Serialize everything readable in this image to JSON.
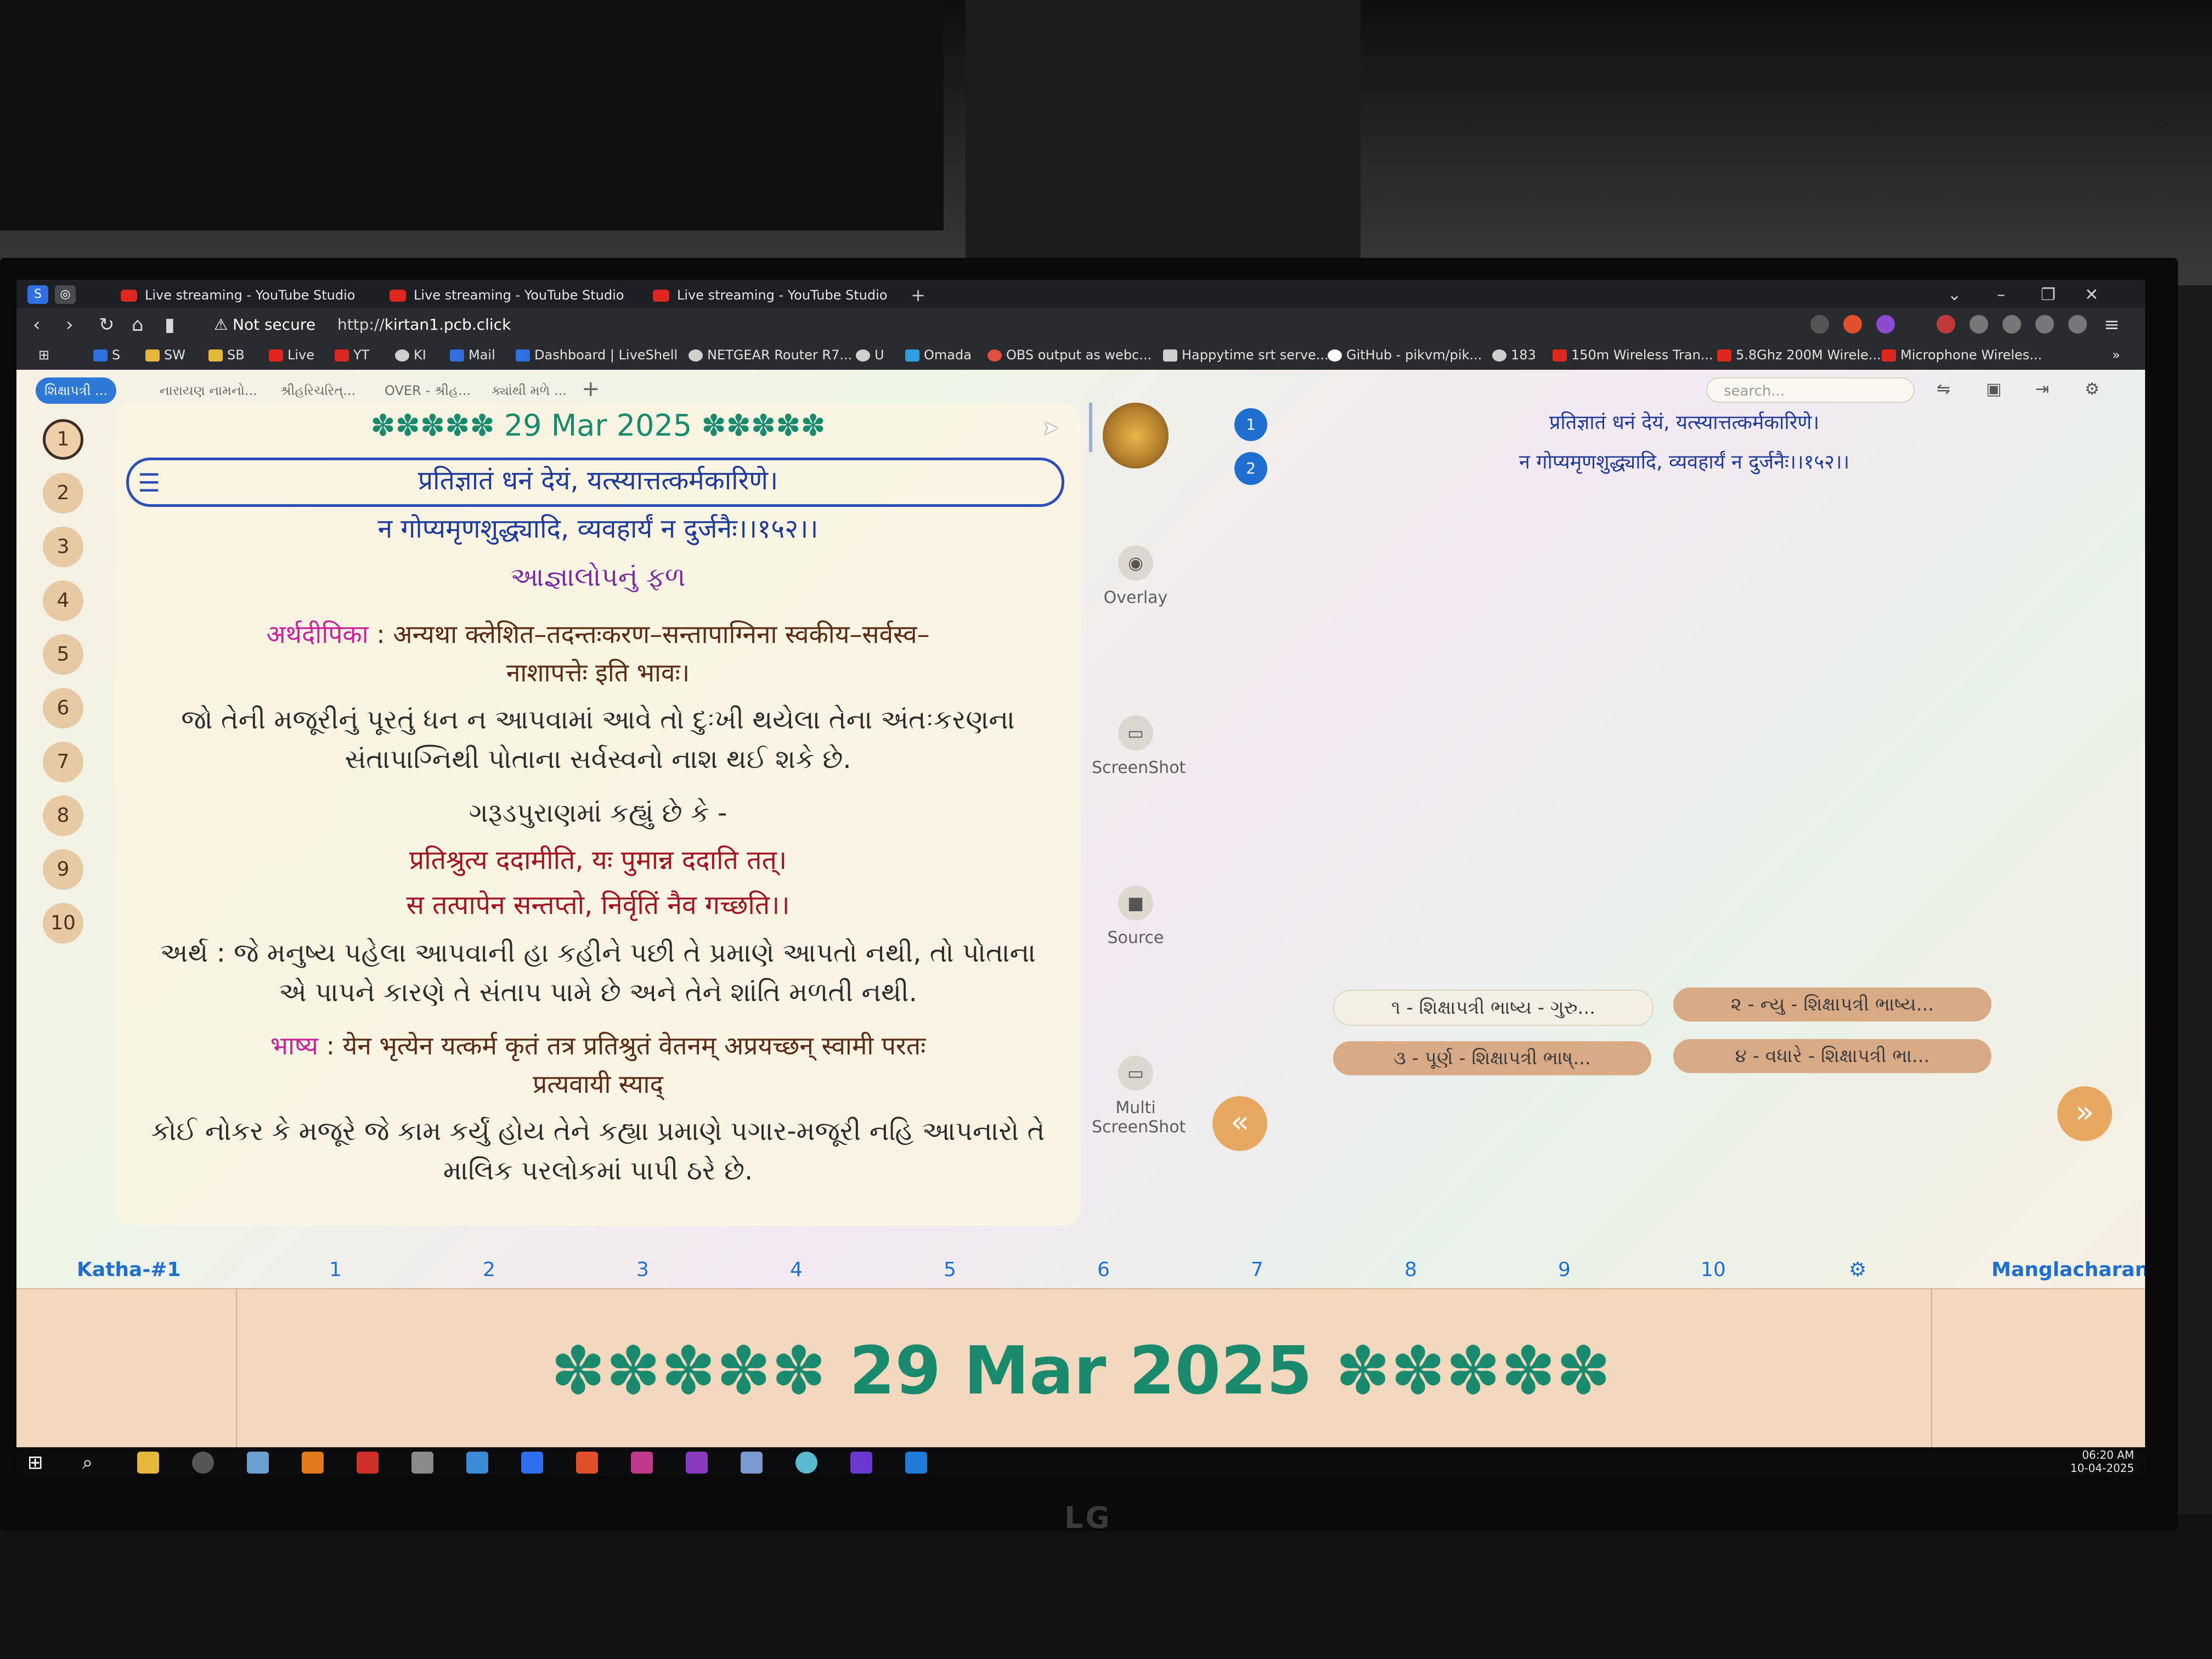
{
  "browser": {
    "tabs": [
      {
        "label": "Live streaming - YouTube Studio"
      },
      {
        "label": "Live streaming - YouTube Studio"
      },
      {
        "label": "Live streaming - YouTube Studio"
      }
    ],
    "new_tab": "+",
    "security_label": "Not secure",
    "url_scheme": "http://",
    "url_host": "kirtan1.pcb.click"
  },
  "bookmarks": [
    {
      "label": "S",
      "icon": "brave-icon",
      "color": "#2f6fe0"
    },
    {
      "label": "SW",
      "icon": "folder-icon",
      "color": "#e5b73b"
    },
    {
      "label": "SB",
      "icon": "folder-icon",
      "color": "#e5b73b"
    },
    {
      "label": "Live",
      "icon": "youtube-icon",
      "color": "#e0271f"
    },
    {
      "label": "YT",
      "icon": "youtube-icon",
      "color": "#e0271f"
    },
    {
      "label": "KI",
      "icon": "globe-icon",
      "color": "#cfcfcf"
    },
    {
      "label": "Mail",
      "icon": "mail-icon",
      "color": "#2f6fe0"
    },
    {
      "label": "Dashboard | LiveShell",
      "icon": "liveshell-icon",
      "color": "#2f6fe0"
    },
    {
      "label": "NETGEAR Router R7...",
      "icon": "globe-icon",
      "color": "#cfcfcf"
    },
    {
      "label": "U",
      "icon": "globe-icon",
      "color": "#cfcfcf"
    },
    {
      "label": "Omada",
      "icon": "omada-icon",
      "color": "#2f9fe0"
    },
    {
      "label": "OBS output as webc...",
      "icon": "obs-icon",
      "color": "#e05040"
    },
    {
      "label": "Happytime srt serve...",
      "icon": "doc-icon",
      "color": "#cfcfcf"
    },
    {
      "label": "GitHub - pikvm/pik...",
      "icon": "github-icon",
      "color": "#ffffff"
    },
    {
      "label": "183",
      "icon": "globe-icon",
      "color": "#cfcfcf"
    },
    {
      "label": "150m Wireless Tran...",
      "icon": "shop-icon",
      "color": "#e0271f"
    },
    {
      "label": "5.8Ghz 200M Wirele...",
      "icon": "shop-icon",
      "color": "#e0271f"
    },
    {
      "label": "Microphone Wireles...",
      "icon": "shop-icon",
      "color": "#e0271f"
    }
  ],
  "app": {
    "tabs": [
      "શિક્ષાપત્રી ...",
      "નારાયણ નામનો...",
      "શ્રીહરિચરિત્...",
      "OVER - શ્રીહ...",
      "ક્યાંથી મળે ..."
    ],
    "search_placeholder": "search...",
    "rail_numbers": [
      "1",
      "2",
      "3",
      "4",
      "5",
      "6",
      "7",
      "8",
      "9",
      "10"
    ],
    "selected_number": "1",
    "content": {
      "date_header": "✽✽✽✽✽ 29 Mar 2025 ✽✽✽✽✽",
      "verse_line1": "प्रतिज्ञातं धनं देयं, यत्स्यात्तत्कर्मकारिणे।",
      "verse_line2": "न गोप्यमृणशुद्ध्यादि, व्यवहार्यं न दुर्जनैः।।१५२।।",
      "guj_title": "આજ્ઞાલોપનું ફળ",
      "arth_label": "अर्थदीपिका",
      "arth_text1": ": अन्यथा क्लेशित–तदन्तःकरण–सन्तापाग्निना स्वकीय–सर्वस्व–",
      "arth_text2": "नाशापत्तेः इति भावः।",
      "guj_exp1": "જો તેની મજૂરીનું પૂરતું ધન ન આપવામાં આવે તો દુઃખી થયેલા તેના અંતઃકરણના",
      "guj_exp2": "સંતાપાગ્નિથી પોતાના સર્વસ્વનો નાશ થઈ શકે છે.",
      "garuda": "ગરૂડપુરાણમાં કહ્યું છે કે -",
      "shloka1": "प्रतिश्रुत्य ददामीति, यः पुमान्न ददाति तत्।",
      "shloka2": "स तत्पापेन सन्तप्तो, निर्वृतिं नैव गच्छति।।",
      "meaning1": "અર્થ : જે મનુષ્ય પહેલા આપવાની હા કહીને પછી તે પ્રમાણે આપતો નથી, તો પોતાના",
      "meaning2": "એ પાપને કારણે તે સંતાપ પામે છે અને તેને શાંતિ મળતી નથી.",
      "bhashya_label": "भाष्य",
      "bhashya1": ": येन भृत्येन यत्कर्म कृतं तत्र प्रतिश्रुतं वेतनम् अप्रयच्छन् स्वामी परतः",
      "bhashya2": "प्रत्यवायी स्याद्",
      "final1": "કોઈ નોકર કે મજૂરે જે કામ કર્યું હોય તેને કહ્યા પ્રમાણે પગાર-મજૂરી નહિ આપનારો તે",
      "final2": "માલિક પરલોકમાં પાપી ઠરે છે."
    },
    "side_buttons": [
      {
        "label": "Overlay",
        "icon": "eye-icon"
      },
      {
        "label": "ScreenShot",
        "icon": "screenshot-icon"
      },
      {
        "label": "Source",
        "icon": "camera-icon"
      },
      {
        "label": "Multi ScreenShot",
        "icon": "multi-screenshot-icon"
      }
    ],
    "right": {
      "numbers": [
        "1",
        "2"
      ],
      "line1": "प्रतिज्ञातं धनं देयं, यत्स्यात्तत्कर्मकारिणे।",
      "line2": "न गोप्यमृणशुद्ध्यादि, व्यवहार्यं न दुर्जनैः।।१५२।।",
      "chips": [
        "૧ - શિક્ષાપત્રી ભાષ્ય - ગુરુ...",
        "૨ - ન્યુ - શિક્ષાપત્રી ભાષ્ય...",
        "૩ - પૂર્ણ - શિક્ષાપત્રી ભાષ્...",
        "૪ - વધારે - શિક્ષાપત્રી ભા..."
      ],
      "prev": "«",
      "next": "»"
    },
    "pagebar": {
      "first": "Katha-#1",
      "pages": [
        "1",
        "2",
        "3",
        "4",
        "5",
        "6",
        "7",
        "8",
        "9",
        "10"
      ],
      "last": "Manglacharan"
    },
    "big_date": "✽✽✽✽✽ 29 Mar 2025 ✽✽✽✽✽"
  },
  "taskbar": {
    "time": "06:20 AM",
    "date": "10-04-2025"
  },
  "monitor_brand": "LG"
}
